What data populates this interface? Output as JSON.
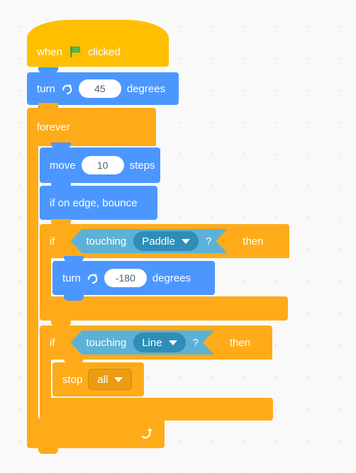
{
  "editor": {
    "name": "scratch-block-workspace",
    "background_color": "#f9f9f9",
    "grid_dot_color": "#dcdcdc"
  },
  "palette": {
    "events": "#ffbf00",
    "motion": "#4c97ff",
    "control": "#ffab19",
    "sensing": "#5cb1d6"
  },
  "script": {
    "hat": {
      "prefix": "when",
      "icon": "green-flag-icon",
      "suffix": "clicked"
    },
    "turn_top": {
      "label": "turn",
      "icon": "turn-clockwise-icon",
      "value": "45",
      "unit": "degrees"
    },
    "forever": {
      "label": "forever",
      "loop_icon": "loop-arrow-icon"
    },
    "move": {
      "label": "move",
      "value": "10",
      "unit": "steps"
    },
    "bounce": {
      "label": "if on edge, bounce"
    },
    "if_paddle": {
      "if_label": "if",
      "then_label": "then",
      "condition": {
        "label": "touching",
        "target": "Paddle",
        "question": "?"
      },
      "body": {
        "label": "turn",
        "icon": "turn-clockwise-icon",
        "value": "-180",
        "unit": "degrees"
      }
    },
    "if_line": {
      "if_label": "if",
      "then_label": "then",
      "condition": {
        "label": "touching",
        "target": "Line",
        "question": "?"
      },
      "body": {
        "label": "stop",
        "option": "all"
      }
    }
  }
}
